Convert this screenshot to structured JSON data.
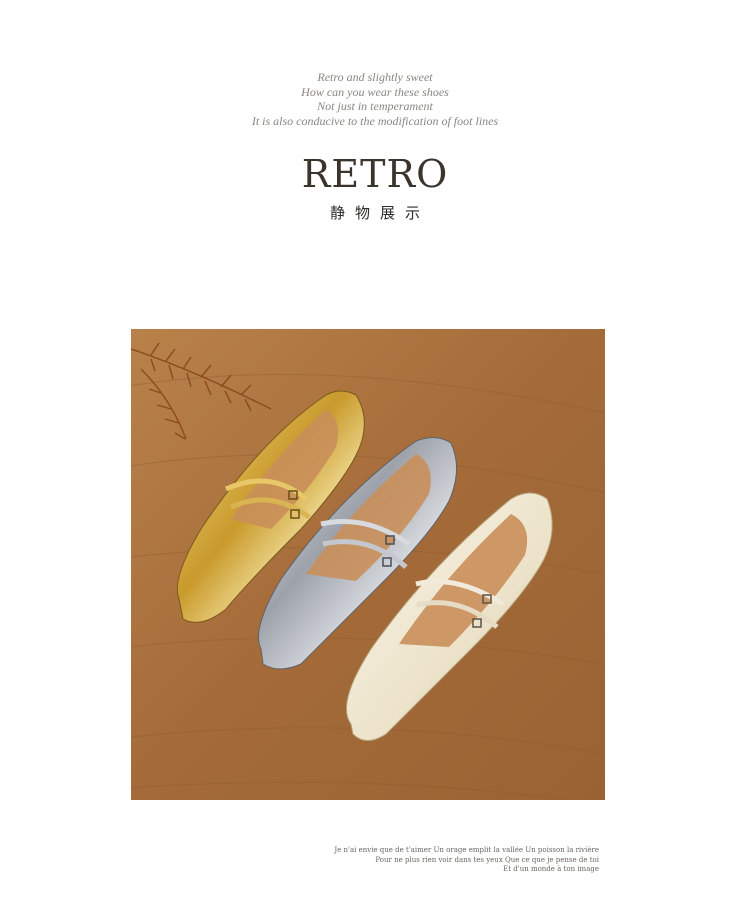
{
  "intro": {
    "line1": "Retro and slightly sweet",
    "line2": "How can you wear these shoes",
    "line3": "Not just in temperament",
    "line4": "It is also conducive to the modification of foot lines"
  },
  "title": "RETRO",
  "subtitle": "静物展示",
  "photo": {
    "subject": "three mary-jane flats with double buckle straps on wood",
    "shoe_colors": [
      "#d9b44a",
      "#b8bcc2",
      "#ece3cf"
    ],
    "background_color": "#a8713f"
  },
  "caption": {
    "line1": "Je n'ai envie que de t'aimer Un orage emplit la vallée Un poisson la rivière",
    "line2": "Pour ne plus rien voir dans tes yeux Que ce que je pense de toi",
    "line3": "Et d'un monde à ton image"
  }
}
